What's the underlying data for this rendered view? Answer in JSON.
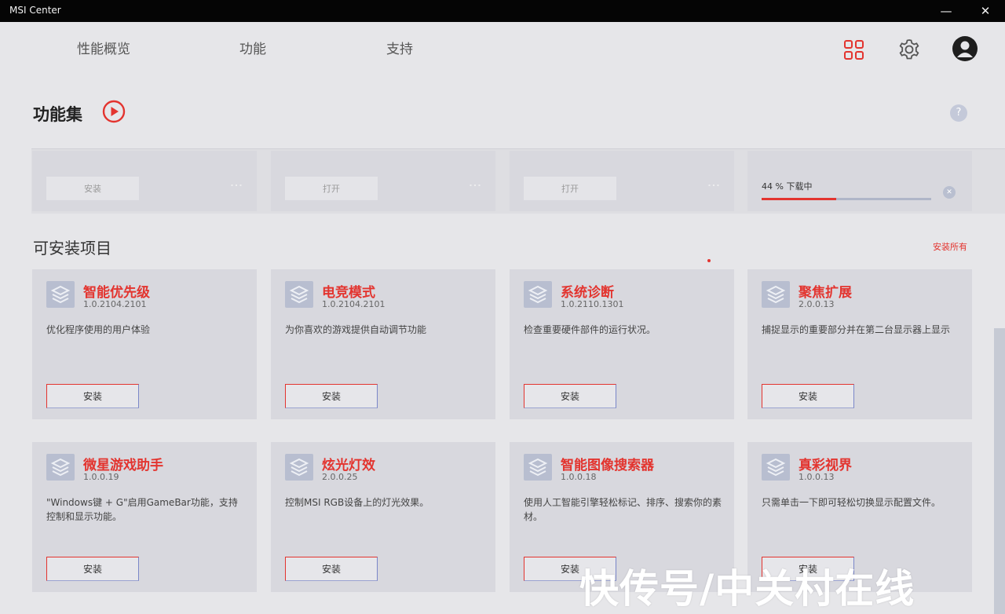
{
  "window": {
    "title": "MSI Center",
    "minimize": "—",
    "close": "✕"
  },
  "nav": {
    "tabs": [
      "性能概览",
      "功能",
      "支持"
    ]
  },
  "header_icons": [
    "apps-grid-icon",
    "gear-icon",
    "avatar"
  ],
  "section": {
    "title": "功能集",
    "help": "?"
  },
  "installed": [
    {
      "button": "安装",
      "menu": "⋮"
    },
    {
      "button": "打开",
      "menu": "⋮"
    },
    {
      "button": "打开",
      "menu": "⋮"
    },
    {
      "progress_label": "44 % 下载中",
      "progress": 0.44
    }
  ],
  "available": {
    "title": "可安装项目",
    "install_all": "安装所有",
    "items": [
      {
        "name": "智能优先级",
        "version": "1.0.2104.2101",
        "desc": "优化程序使用的用户体验",
        "button": "安装"
      },
      {
        "name": "电竞模式",
        "version": "1.0.2104.2101",
        "desc": "为你喜欢的游戏提供自动调节功能",
        "button": "安装"
      },
      {
        "name": "系统诊断",
        "version": "1.0.2110.1301",
        "desc": "检查重要硬件部件的运行状况。",
        "button": "安装"
      },
      {
        "name": "聚焦扩展",
        "version": "2.0.0.13",
        "desc": "捕捉显示的重要部分并在第二台显示器上显示",
        "button": "安装"
      },
      {
        "name": "微星游戏助手",
        "version": "1.0.0.19",
        "desc": "\"Windows键 + G\"启用GameBar功能，支持控制和显示功能。",
        "button": "安装"
      },
      {
        "name": "炫光灯效",
        "version": "2.0.0.25",
        "desc": "控制MSI RGB设备上的灯光效果。",
        "button": "安装"
      },
      {
        "name": "智能图像搜索器",
        "version": "1.0.0.18",
        "desc": "使用人工智能引擎轻松标记、排序、搜索你的素材。",
        "button": "安装"
      },
      {
        "name": "真彩视界",
        "version": "1.0.0.13",
        "desc": "只需单击一下即可轻松切换显示配置文件。",
        "button": "安装"
      }
    ]
  },
  "watermark": "快传号/中关村在线",
  "colors": {
    "accent": "#e3342f",
    "card": "#d8d8de",
    "background": "#e6e6e9"
  }
}
